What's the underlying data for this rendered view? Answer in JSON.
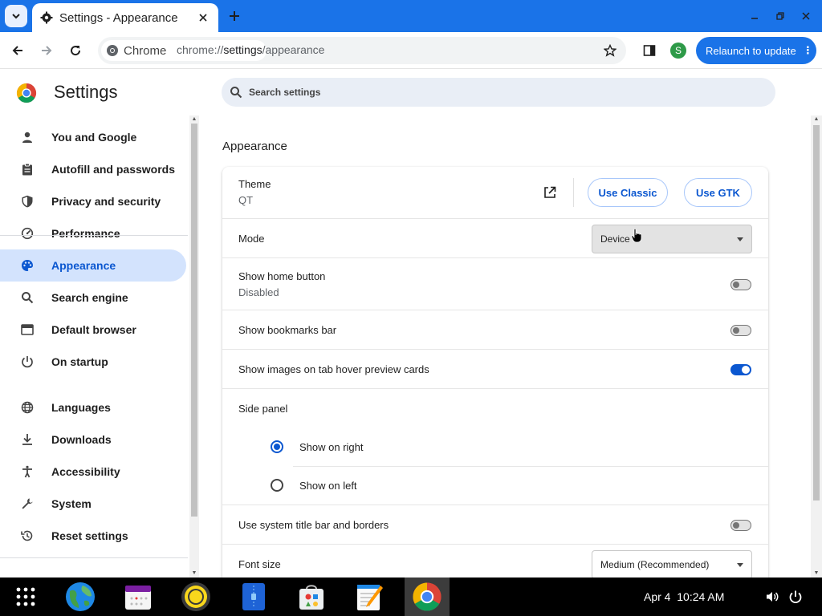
{
  "browser": {
    "tab_title": "Settings - Appearance",
    "chip_label": "Chrome",
    "url_prefix": "chrome://",
    "url_host": "settings",
    "url_path": "/appearance",
    "profile_initial": "S",
    "relaunch_label": "Relaunch to update",
    "relaunch_more": "⋮"
  },
  "settings": {
    "title": "Settings",
    "search_placeholder": "Search settings",
    "nav": [
      {
        "label": "You and Google",
        "icon": "person-icon"
      },
      {
        "label": "Autofill and passwords",
        "icon": "clipboard-icon"
      },
      {
        "label": "Privacy and security",
        "icon": "shield-icon"
      },
      {
        "label": "Performance",
        "icon": "speedometer-icon"
      },
      {
        "label": "Appearance",
        "icon": "palette-icon",
        "active": true
      },
      {
        "label": "Search engine",
        "icon": "search-icon"
      },
      {
        "label": "Default browser",
        "icon": "browser-window-icon"
      },
      {
        "label": "On startup",
        "icon": "power-icon"
      },
      {
        "label": "Languages",
        "icon": "globe-icon"
      },
      {
        "label": "Downloads",
        "icon": "download-icon"
      },
      {
        "label": "Accessibility",
        "icon": "accessibility-icon"
      },
      {
        "label": "System",
        "icon": "wrench-icon"
      },
      {
        "label": "Reset settings",
        "icon": "history-icon"
      }
    ]
  },
  "appearance": {
    "section_title": "Appearance",
    "theme": {
      "title": "Theme",
      "value": "QT",
      "classic_label": "Use Classic",
      "gtk_label": "Use GTK"
    },
    "mode": {
      "title": "Mode",
      "value": "Device"
    },
    "home_button": {
      "title": "Show home button",
      "sub": "Disabled",
      "on": false
    },
    "bookmarks_bar": {
      "title": "Show bookmarks bar",
      "on": false
    },
    "hover_cards": {
      "title": "Show images on tab hover preview cards",
      "on": true
    },
    "side_panel": {
      "title": "Side panel",
      "options": [
        "Show on right",
        "Show on left"
      ],
      "selected": "Show on right"
    },
    "title_bar": {
      "title": "Use system title bar and borders",
      "on": false
    },
    "font_size": {
      "title": "Font size",
      "value": "Medium (Recommended)"
    }
  },
  "taskbar": {
    "date": "Apr 4",
    "time": "10:24 AM",
    "apps": [
      "launcher-icon",
      "browser-globe-icon",
      "calendar-icon",
      "music-player-icon",
      "text-document-icon",
      "store-bag-icon",
      "notepad-icon",
      "chrome-icon"
    ]
  },
  "colors": {
    "accent": "#1a73e8",
    "active_nav_bg": "#d3e3fd",
    "active_text": "#0b57d0"
  }
}
